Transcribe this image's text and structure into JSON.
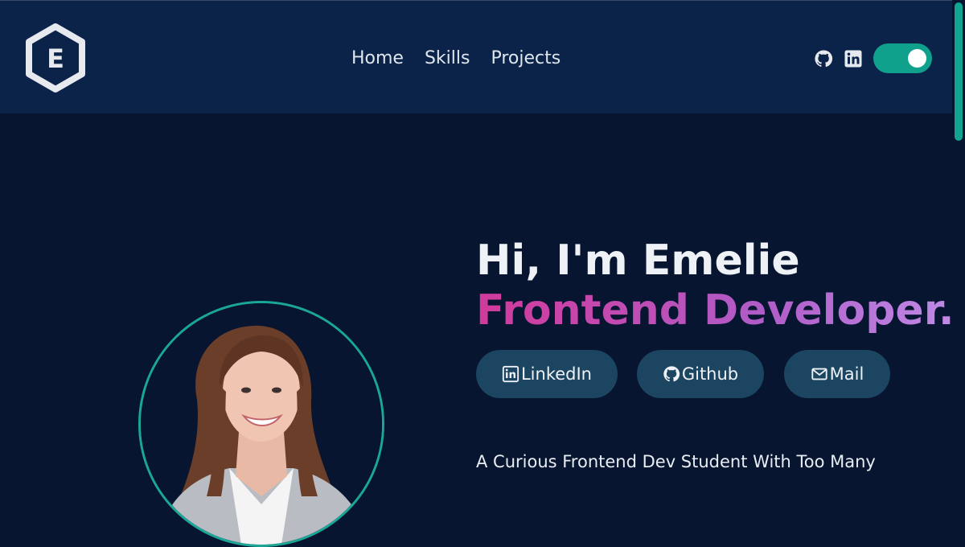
{
  "header": {
    "logo_letter": "E",
    "nav": [
      {
        "label": "Home",
        "icon": "home"
      },
      {
        "label": "Skills",
        "icon": "skills"
      },
      {
        "label": "Projects",
        "icon": "projects"
      }
    ],
    "icons": [
      "github-icon",
      "linkedin-icon"
    ],
    "theme_toggle_on": true
  },
  "hero": {
    "greeting": "Hi, I'm Emelie",
    "role": "Frontend Developer.",
    "buttons": [
      {
        "label": "LinkedIn",
        "icon": "linkedin-icon"
      },
      {
        "label": "Github",
        "icon": "github-icon"
      },
      {
        "label": "Mail",
        "icon": "mail-icon"
      }
    ],
    "tagline": "A Curious Frontend Dev Student With Too Many"
  },
  "colors": {
    "header_bg": "#0b2249",
    "page_bg": "#071530",
    "accent": "#10a18d",
    "button_bg": "#1b4560",
    "gradient_start": "#d23a9b",
    "gradient_end": "#c08ae6"
  }
}
